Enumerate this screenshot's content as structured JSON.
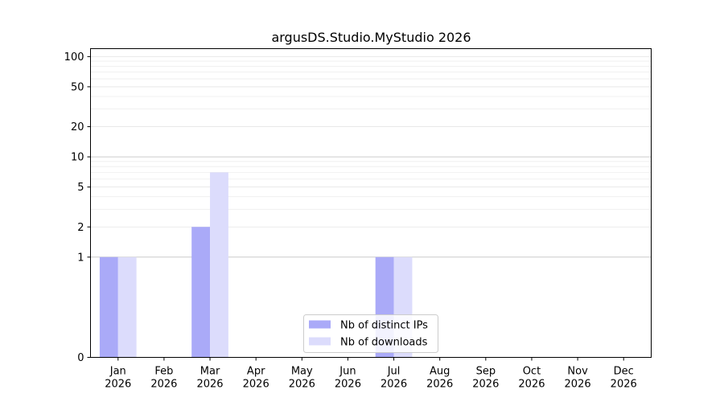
{
  "chart_data": {
    "type": "bar",
    "title": "argusDS.Studio.MyStudio 2026",
    "xlabel": "",
    "ylabel": "",
    "categories": [
      [
        "Jan",
        "2026"
      ],
      [
        "Feb",
        "2026"
      ],
      [
        "Mar",
        "2026"
      ],
      [
        "Apr",
        "2026"
      ],
      [
        "May",
        "2026"
      ],
      [
        "Jun",
        "2026"
      ],
      [
        "Jul",
        "2026"
      ],
      [
        "Aug",
        "2026"
      ],
      [
        "Sep",
        "2026"
      ],
      [
        "Oct",
        "2026"
      ],
      [
        "Nov",
        "2026"
      ],
      [
        "Dec",
        "2026"
      ]
    ],
    "series": [
      {
        "name": "Nb of distinct IPs",
        "color": "#aaaaf8",
        "values": [
          1,
          0,
          2,
          0,
          0,
          0,
          1,
          0,
          0,
          0,
          0,
          0
        ]
      },
      {
        "name": "Nb of downloads",
        "color": "#dcdcfc",
        "values": [
          1,
          0,
          7,
          0,
          0,
          0,
          1,
          0,
          0,
          0,
          0,
          0
        ]
      }
    ],
    "yscale": "symlog",
    "ylim": [
      0,
      120
    ],
    "yticks": [
      0,
      1,
      2,
      5,
      10,
      20,
      50,
      100
    ],
    "grid": true,
    "legend_position": "lower-center"
  }
}
